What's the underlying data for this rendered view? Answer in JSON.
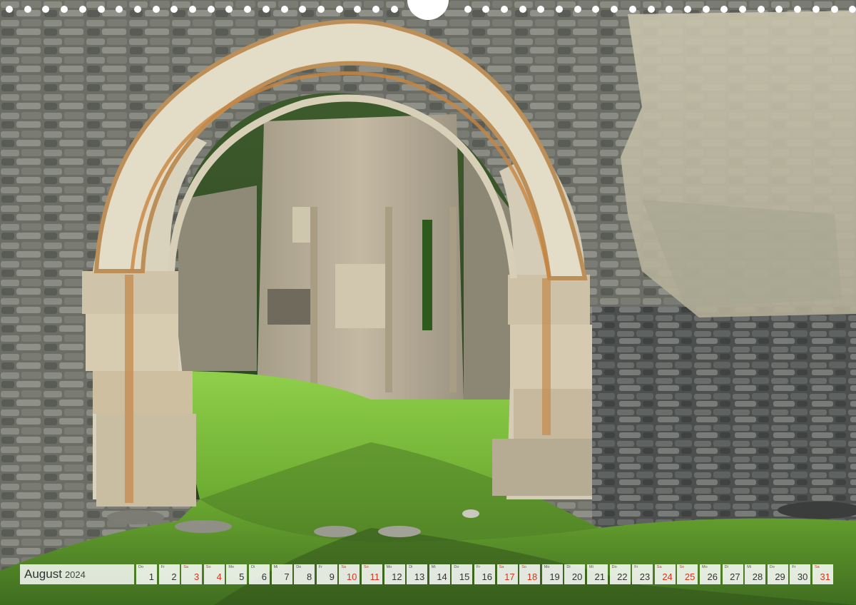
{
  "calendar": {
    "month": "August",
    "year": "2024",
    "weekend_color": "#d4381f",
    "days": [
      {
        "n": "1",
        "wd": "Do",
        "we": false
      },
      {
        "n": "2",
        "wd": "Fr",
        "we": false
      },
      {
        "n": "3",
        "wd": "Sa",
        "we": true
      },
      {
        "n": "4",
        "wd": "So",
        "we": true
      },
      {
        "n": "5",
        "wd": "Mo",
        "we": false
      },
      {
        "n": "6",
        "wd": "Di",
        "we": false
      },
      {
        "n": "7",
        "wd": "Mi",
        "we": false
      },
      {
        "n": "8",
        "wd": "Do",
        "we": false
      },
      {
        "n": "9",
        "wd": "Fr",
        "we": false
      },
      {
        "n": "10",
        "wd": "Sa",
        "we": true
      },
      {
        "n": "11",
        "wd": "So",
        "we": true
      },
      {
        "n": "12",
        "wd": "Mo",
        "we": false
      },
      {
        "n": "13",
        "wd": "Di",
        "we": false
      },
      {
        "n": "14",
        "wd": "Mi",
        "we": false
      },
      {
        "n": "15",
        "wd": "Do",
        "we": false
      },
      {
        "n": "16",
        "wd": "Fr",
        "we": false
      },
      {
        "n": "17",
        "wd": "Sa",
        "we": true
      },
      {
        "n": "18",
        "wd": "So",
        "we": true
      },
      {
        "n": "19",
        "wd": "Mo",
        "we": false
      },
      {
        "n": "20",
        "wd": "Di",
        "we": false
      },
      {
        "n": "21",
        "wd": "Mi",
        "we": false
      },
      {
        "n": "22",
        "wd": "Do",
        "we": false
      },
      {
        "n": "23",
        "wd": "Fr",
        "we": false
      },
      {
        "n": "24",
        "wd": "Sa",
        "we": true
      },
      {
        "n": "25",
        "wd": "So",
        "we": true
      },
      {
        "n": "26",
        "wd": "Mo",
        "we": false
      },
      {
        "n": "27",
        "wd": "Di",
        "we": false
      },
      {
        "n": "28",
        "wd": "Mi",
        "we": false
      },
      {
        "n": "29",
        "wd": "Do",
        "we": false
      },
      {
        "n": "30",
        "wd": "Fr",
        "we": false
      },
      {
        "n": "31",
        "wd": "Sa",
        "we": true
      }
    ]
  },
  "photo": {
    "subject": "ruined-gothic-church-arch"
  }
}
